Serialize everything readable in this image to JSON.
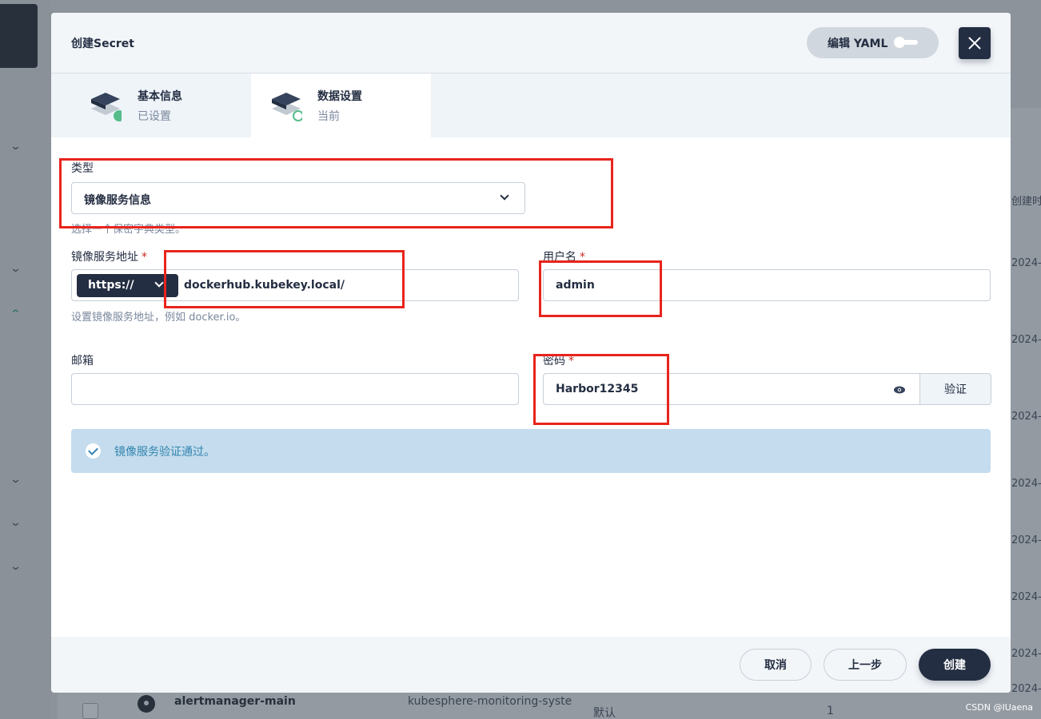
{
  "background": {
    "right_column_header": "创建时",
    "right_column_dates": [
      "2024-",
      "2024-",
      "2024-",
      "2024-",
      "2024-",
      "2024-",
      "2024-",
      "2024-"
    ],
    "row": {
      "name": "alertmanager-main",
      "project": "kubesphere-monitoring-syste",
      "type": "默认",
      "count": "1"
    },
    "watermark": "CSDN @IUaena"
  },
  "modal": {
    "title": "创建Secret",
    "yaml_toggle_label": "编辑 YAML",
    "steps": [
      {
        "title": "基本信息",
        "subtitle": "已设置"
      },
      {
        "title": "数据设置",
        "subtitle": "当前"
      }
    ],
    "form": {
      "type_label": "类型",
      "type_value": "镜像服务信息",
      "type_hint": "选择一个保密字典类型。",
      "registry_label": "镜像服务地址",
      "registry_protocol": "https://",
      "registry_value": "dockerhub.kubekey.local/",
      "registry_hint": "设置镜像服务地址，例如 docker.io。",
      "username_label": "用户名",
      "username_value": "admin",
      "email_label": "邮箱",
      "email_value": "",
      "password_label": "密码",
      "password_value": "Harbor12345",
      "verify_label": "验证",
      "required_mark": "*"
    },
    "alert_text": "镜像服务验证通过。",
    "footer": {
      "cancel": "取消",
      "previous": "上一步",
      "create": "创建"
    }
  },
  "colors": {
    "primary": "#242e42",
    "success": "#55bc8a",
    "info_bg": "#c4dced",
    "info_text": "#3385b0",
    "annotation": "#e8241c"
  }
}
